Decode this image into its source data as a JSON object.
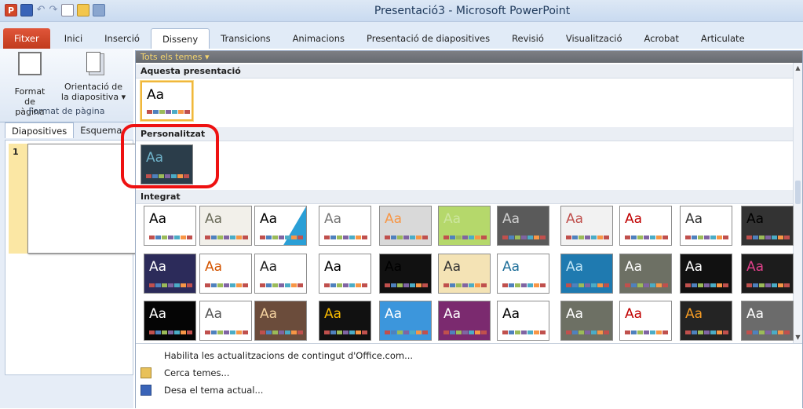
{
  "window": {
    "title": "Presentació3 - Microsoft PowerPoint",
    "app_icon": "P"
  },
  "quick_access": {
    "undo_symbol": "↶",
    "redo_symbol": "↷"
  },
  "tabs": [
    "Fitxer",
    "Inici",
    "Inserció",
    "Disseny",
    "Transicions",
    "Animacions",
    "Presentació de diapositives",
    "Revisió",
    "Visualització",
    "Acrobat",
    "Articulate"
  ],
  "active_tab": "Disseny",
  "ribbon": {
    "format_button_l1": "Format",
    "format_button_l2": "de pàgina",
    "orientation_button_l1": "Orientació de",
    "orientation_button_l2": "la diapositiva ▾",
    "group_label": "Format de pàgina"
  },
  "slides_panel": {
    "tabs": [
      "Diapositives",
      "Esquema"
    ],
    "slide_number": "1"
  },
  "gallery": {
    "header": "Tots els temes ▾",
    "sections": {
      "this_presentation": "Aquesta presentació",
      "custom": "Personalitzat",
      "builtin": "Integrat"
    },
    "thumb_text": "Aa",
    "menu": [
      {
        "label": "Habilita les actualitzacions de contingut d'Office.com...",
        "icon": "none"
      },
      {
        "label": "Cerca temes...",
        "icon": "folder-icon"
      },
      {
        "label": "Desa el tema actual...",
        "icon": "save-icon"
      }
    ]
  },
  "theme_rows": [
    [
      {
        "bg": "#ffffff",
        "fg": "#000000"
      },
      {
        "bg": "#f2f0ea",
        "fg": "#6b6b5a"
      },
      {
        "bg": "#ffffff",
        "fg": "#000000",
        "accent": "#2a9fd6"
      },
      {
        "bg": "#ffffff",
        "fg": "#777777"
      },
      {
        "bg": "#d9d9d9",
        "fg": "#f79646"
      },
      {
        "bg": "#b5d86b",
        "fg": "#cde6a0"
      },
      {
        "bg": "#5a5a5a",
        "fg": "#cfcfcf"
      },
      {
        "bg": "#f2f2f2",
        "fg": "#c0504d"
      },
      {
        "bg": "#ffffff",
        "fg": "#c00000"
      },
      {
        "bg": "#ffffff",
        "fg": "#333333"
      },
      {
        "bg": "#333333",
        "fg": "#000000"
      }
    ],
    [
      {
        "bg": "#2c2b5a",
        "fg": "#ffffff"
      },
      {
        "bg": "#ffffff",
        "fg": "#d35400"
      },
      {
        "bg": "#ffffff",
        "fg": "#222222"
      },
      {
        "bg": "#ffffff",
        "fg": "#000000"
      },
      {
        "bg": "#111111",
        "fg": "#000000"
      },
      {
        "bg": "#f4e3b5",
        "fg": "#333333"
      },
      {
        "bg": "#ffffff",
        "fg": "#1f6f9a"
      },
      {
        "bg": "#1f7ab0",
        "fg": "#bfe4f5"
      },
      {
        "bg": "#6d7064",
        "fg": "#ffffff"
      },
      {
        "bg": "#111111",
        "fg": "#ffffff"
      },
      {
        "bg": "#1c1c1c",
        "fg": "#e0408a"
      }
    ],
    [
      {
        "bg": "#050505",
        "fg": "#ffffff"
      },
      {
        "bg": "#ffffff",
        "fg": "#555555"
      },
      {
        "bg": "#6b4c3b",
        "fg": "#f4d2a0"
      },
      {
        "bg": "#111111",
        "fg": "#f6b800"
      },
      {
        "bg": "#3c96dc",
        "fg": "#ffffff"
      },
      {
        "bg": "#7b2a6f",
        "fg": "#ffffff"
      },
      {
        "bg": "#ffffff",
        "fg": "#000000"
      },
      {
        "bg": "#6d7064",
        "fg": "#ffffff"
      },
      {
        "bg": "#ffffff",
        "fg": "#c00000"
      },
      {
        "bg": "#242424",
        "fg": "#f39a24"
      },
      {
        "bg": "#6b6b6b",
        "fg": "#ffffff"
      }
    ]
  ],
  "swatches": [
    "#c0504d",
    "#4f81bd",
    "#9bbb59",
    "#8064a2",
    "#4bacc6",
    "#f79646",
    "#c0504d"
  ]
}
